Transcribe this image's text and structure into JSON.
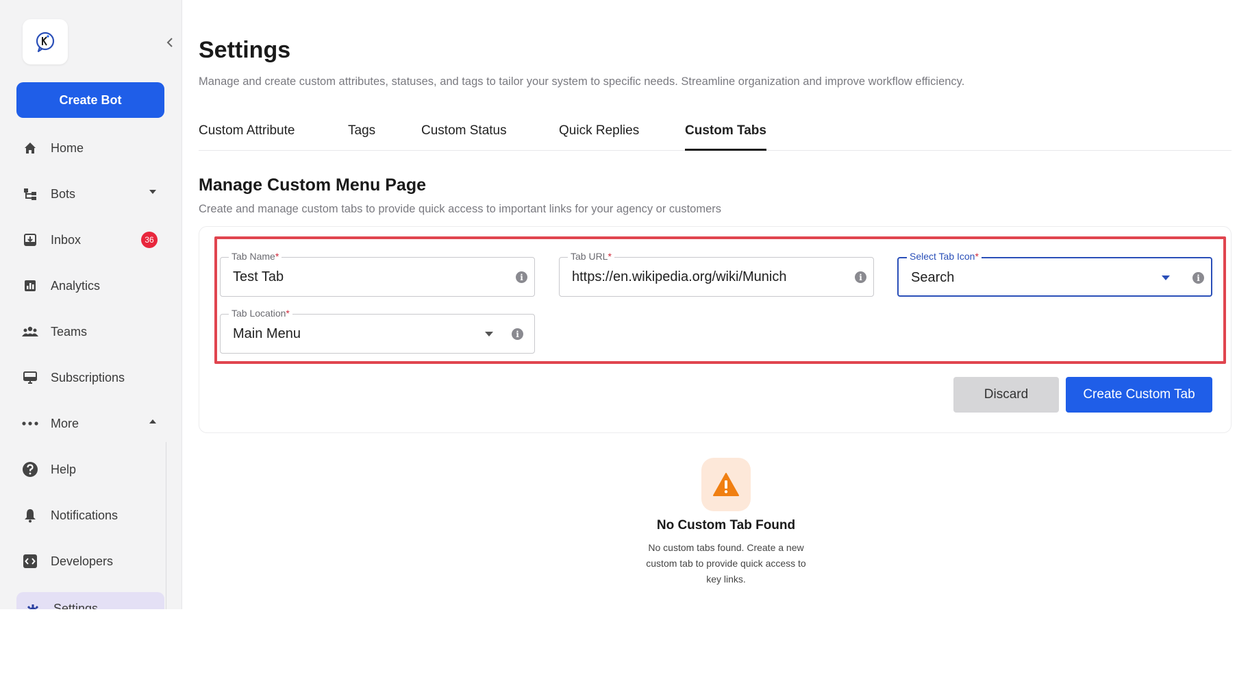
{
  "sidebar": {
    "create_bot_label": "Create Bot",
    "items": [
      {
        "label": "Home",
        "icon": "home-icon"
      },
      {
        "label": "Bots",
        "icon": "bots-icon"
      },
      {
        "label": "Inbox",
        "icon": "inbox-icon",
        "badge": "36"
      },
      {
        "label": "Analytics",
        "icon": "analytics-icon"
      },
      {
        "label": "Teams",
        "icon": "teams-icon"
      },
      {
        "label": "Subscriptions",
        "icon": "subscriptions-icon"
      },
      {
        "label": "More",
        "icon": "more-icon"
      },
      {
        "label": "Help",
        "icon": "help-icon"
      },
      {
        "label": "Notifications",
        "icon": "bell-icon"
      },
      {
        "label": "Developers",
        "icon": "code-icon"
      },
      {
        "label": "Settings",
        "icon": "gear-icon"
      }
    ]
  },
  "header": {
    "title": "Settings",
    "description": "Manage and create custom attributes, statuses, and tags to tailor your system to specific needs. Streamline organization and improve workflow efficiency."
  },
  "tabs": [
    {
      "label": "Custom Attribute",
      "active": false
    },
    {
      "label": "Tags",
      "active": false
    },
    {
      "label": "Custom Status",
      "active": false
    },
    {
      "label": "Quick Replies",
      "active": false
    },
    {
      "label": "Custom Tabs",
      "active": true
    }
  ],
  "section": {
    "title": "Manage Custom Menu Page",
    "description": "Create and manage custom tabs to provide quick access to important links for your agency or customers"
  },
  "form": {
    "tab_name": {
      "label": "Tab Name",
      "required": "*",
      "value": "Test Tab"
    },
    "tab_url": {
      "label": "Tab URL",
      "required": "*",
      "value": "https://en.wikipedia.org/wiki/Munich"
    },
    "tab_icon": {
      "label": "Select Tab Icon",
      "required": "*",
      "value": "Search"
    },
    "tab_location": {
      "label": "Tab Location",
      "required": "*",
      "value": "Main Menu"
    },
    "info_glyph": "i",
    "discard_label": "Discard",
    "create_label": "Create Custom Tab"
  },
  "empty_state": {
    "title": "No Custom Tab Found",
    "description": "No custom tabs found. Create a new custom tab to provide quick access to key links."
  },
  "colors": {
    "primary": "#1f5ee8",
    "highlight_border": "#e0454f",
    "badge": "#e8273d",
    "warning": "#f07f12"
  }
}
